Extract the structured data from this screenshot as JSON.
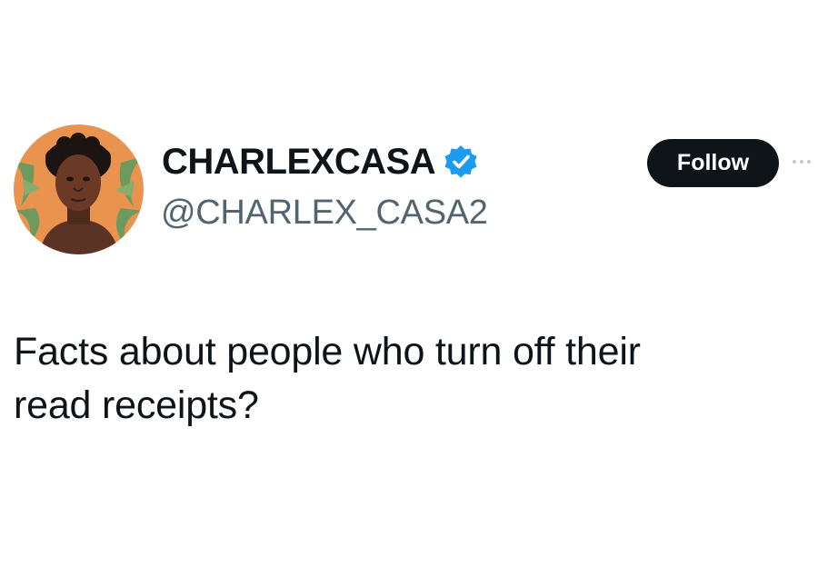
{
  "author": {
    "display_name": "CHARLEXCASA",
    "handle": "@CHARLEX_CASA2",
    "verified_icon": "verified-badge-icon",
    "avatar": "profile-photo"
  },
  "actions": {
    "follow_label": "Follow",
    "more_icon": "more-dots-icon"
  },
  "tweet": {
    "text": "Facts about people who turn off their\nread receipts?"
  },
  "colors": {
    "name": "#0f1419",
    "handle": "#536471",
    "follow_bg": "#0f1419",
    "follow_text": "#ffffff",
    "verified": "#1d9bf0",
    "avatar_bg": "#e9934f"
  }
}
